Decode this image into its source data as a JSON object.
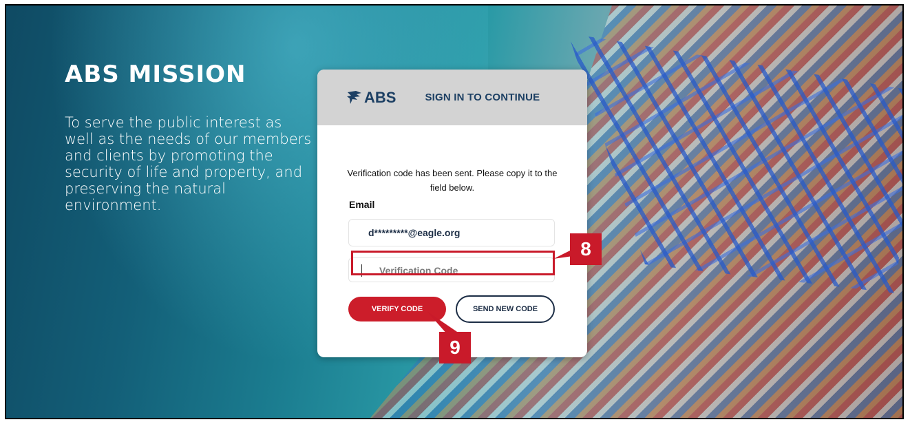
{
  "mission": {
    "title": "ABS MISSION",
    "text": "To serve the public interest as well as the needs of our members and clients by promoting the security of life and property, and preserving the natural environment."
  },
  "card": {
    "logo_text": "ABS",
    "header_title": "SIGN IN TO CONTINUE",
    "message": "Verification code has been sent. Please copy it to the field below.",
    "email_label": "Email",
    "email_value": "d*********@eagle.org",
    "code_placeholder": "Verification Code",
    "verify_button": "VERIFY CODE",
    "send_button": "SEND NEW CODE"
  },
  "callouts": {
    "step8": "8",
    "step9": "9"
  },
  "colors": {
    "accent_red": "#cc1d2a",
    "navy": "#1c2d45"
  },
  "icons": {
    "logo": "abs-eagle-icon"
  }
}
